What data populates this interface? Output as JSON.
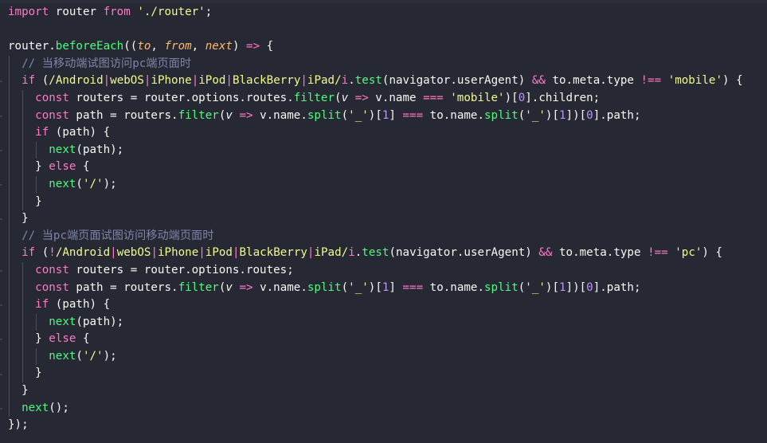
{
  "colors": {
    "background": "#262834",
    "keyword": "#ff79c6",
    "function": "#50fa7b",
    "string": "#f1fa8c",
    "number": "#bd93f9",
    "parameter": "#ffb86c",
    "comment": "#7e84a8",
    "text": "#f8f8f2"
  },
  "lines": [
    {
      "indent": 0,
      "tokens": [
        [
          "kw",
          "import"
        ],
        [
          "pl",
          " router "
        ],
        [
          "kw",
          "from"
        ],
        [
          "pl",
          " "
        ],
        [
          "str",
          "'./router'"
        ],
        [
          "pl",
          ";"
        ]
      ]
    },
    {
      "indent": 0,
      "tokens": []
    },
    {
      "indent": 0,
      "tokens": [
        [
          "pl",
          "router."
        ],
        [
          "fn",
          "beforeEach"
        ],
        [
          "pl",
          "(("
        ],
        [
          "prm",
          "to"
        ],
        [
          "pl",
          ", "
        ],
        [
          "prm",
          "from"
        ],
        [
          "pl",
          ", "
        ],
        [
          "prm",
          "next"
        ],
        [
          "pl",
          ") "
        ],
        [
          "kw",
          "=>"
        ],
        [
          "pl",
          " {"
        ]
      ]
    },
    {
      "indent": 1,
      "tokens": [
        [
          "cmt",
          "// 当移动端试图访问pc端页面时"
        ]
      ]
    },
    {
      "indent": 1,
      "tokens": [
        [
          "kw",
          "if"
        ],
        [
          "pl",
          " ("
        ],
        [
          "rx",
          "/Android"
        ],
        [
          "rxop",
          "|"
        ],
        [
          "rx",
          "webOS"
        ],
        [
          "rxop",
          "|"
        ],
        [
          "rx",
          "iPhone"
        ],
        [
          "rxop",
          "|"
        ],
        [
          "rx",
          "iPod"
        ],
        [
          "rxop",
          "|"
        ],
        [
          "rx",
          "BlackBerry"
        ],
        [
          "rxop",
          "|"
        ],
        [
          "rx",
          "iPad/"
        ],
        [
          "kw",
          "i"
        ],
        [
          "pl",
          "."
        ],
        [
          "fn",
          "test"
        ],
        [
          "pl",
          "(navigator.userAgent) "
        ],
        [
          "kw",
          "&&"
        ],
        [
          "pl",
          " to.meta.type "
        ],
        [
          "kw",
          "!=="
        ],
        [
          "pl",
          " "
        ],
        [
          "str",
          "'mobile'"
        ],
        [
          "pl",
          ") {"
        ]
      ]
    },
    {
      "indent": 2,
      "tokens": [
        [
          "kw",
          "const"
        ],
        [
          "pl",
          " routers = router.options.routes."
        ],
        [
          "fn",
          "filter"
        ],
        [
          "pl",
          "("
        ],
        [
          "vparam",
          "v"
        ],
        [
          "pl",
          " "
        ],
        [
          "kw",
          "=>"
        ],
        [
          "pl",
          " v.name "
        ],
        [
          "kw",
          "==="
        ],
        [
          "pl",
          " "
        ],
        [
          "str",
          "'mobile'"
        ],
        [
          "pl",
          ")["
        ],
        [
          "num",
          "0"
        ],
        [
          "pl",
          "].children;"
        ]
      ]
    },
    {
      "indent": 2,
      "tokens": [
        [
          "kw",
          "const"
        ],
        [
          "pl",
          " path = routers."
        ],
        [
          "fn",
          "filter"
        ],
        [
          "pl",
          "("
        ],
        [
          "vparam",
          "v"
        ],
        [
          "pl",
          " "
        ],
        [
          "kw",
          "=>"
        ],
        [
          "pl",
          " v.name."
        ],
        [
          "fn",
          "split"
        ],
        [
          "pl",
          "("
        ],
        [
          "str",
          "'_'"
        ],
        [
          "pl",
          ")["
        ],
        [
          "num",
          "1"
        ],
        [
          "pl",
          "] "
        ],
        [
          "kw",
          "==="
        ],
        [
          "pl",
          " to.name."
        ],
        [
          "fn",
          "split"
        ],
        [
          "pl",
          "("
        ],
        [
          "str",
          "'_'"
        ],
        [
          "pl",
          ")["
        ],
        [
          "num",
          "1"
        ],
        [
          "pl",
          "])["
        ],
        [
          "num",
          "0"
        ],
        [
          "pl",
          "].path;"
        ]
      ]
    },
    {
      "indent": 2,
      "tokens": [
        [
          "kw",
          "if"
        ],
        [
          "pl",
          " (path) {"
        ]
      ]
    },
    {
      "indent": 3,
      "tokens": [
        [
          "fn",
          "next"
        ],
        [
          "pl",
          "(path);"
        ]
      ]
    },
    {
      "indent": 2,
      "tokens": [
        [
          "pl",
          "} "
        ],
        [
          "kw",
          "else"
        ],
        [
          "pl",
          " {"
        ]
      ]
    },
    {
      "indent": 3,
      "tokens": [
        [
          "fn",
          "next"
        ],
        [
          "pl",
          "("
        ],
        [
          "str",
          "'/'"
        ],
        [
          "pl",
          ");"
        ]
      ]
    },
    {
      "indent": 2,
      "tokens": [
        [
          "pl",
          "}"
        ]
      ]
    },
    {
      "indent": 1,
      "tokens": [
        [
          "pl",
          "}"
        ]
      ]
    },
    {
      "indent": 1,
      "tokens": [
        [
          "cmt",
          "// 当pc端页面试图访问移动端页面时"
        ]
      ]
    },
    {
      "indent": 1,
      "tokens": [
        [
          "kw",
          "if"
        ],
        [
          "pl",
          " ("
        ],
        [
          "kw",
          "!"
        ],
        [
          "rx",
          "/Android"
        ],
        [
          "rxop",
          "|"
        ],
        [
          "rx",
          "webOS"
        ],
        [
          "rxop",
          "|"
        ],
        [
          "rx",
          "iPhone"
        ],
        [
          "rxop",
          "|"
        ],
        [
          "rx",
          "iPod"
        ],
        [
          "rxop",
          "|"
        ],
        [
          "rx",
          "BlackBerry"
        ],
        [
          "rxop",
          "|"
        ],
        [
          "rx",
          "iPad/"
        ],
        [
          "kw",
          "i"
        ],
        [
          "pl",
          "."
        ],
        [
          "fn",
          "test"
        ],
        [
          "pl",
          "(navigator.userAgent) "
        ],
        [
          "kw",
          "&&"
        ],
        [
          "pl",
          " to.meta.type "
        ],
        [
          "kw",
          "!=="
        ],
        [
          "pl",
          " "
        ],
        [
          "str",
          "'pc'"
        ],
        [
          "pl",
          ") {"
        ]
      ]
    },
    {
      "indent": 2,
      "tokens": [
        [
          "kw",
          "const"
        ],
        [
          "pl",
          " routers = router.options.routes;"
        ]
      ]
    },
    {
      "indent": 2,
      "tokens": [
        [
          "kw",
          "const"
        ],
        [
          "pl",
          " path = routers."
        ],
        [
          "fn",
          "filter"
        ],
        [
          "pl",
          "("
        ],
        [
          "vparam",
          "v"
        ],
        [
          "pl",
          " "
        ],
        [
          "kw",
          "=>"
        ],
        [
          "pl",
          " v.name."
        ],
        [
          "fn",
          "split"
        ],
        [
          "pl",
          "("
        ],
        [
          "str",
          "'_'"
        ],
        [
          "pl",
          ")["
        ],
        [
          "num",
          "1"
        ],
        [
          "pl",
          "] "
        ],
        [
          "kw",
          "==="
        ],
        [
          "pl",
          " to.name."
        ],
        [
          "fn",
          "split"
        ],
        [
          "pl",
          "("
        ],
        [
          "str",
          "'_'"
        ],
        [
          "pl",
          ")["
        ],
        [
          "num",
          "1"
        ],
        [
          "pl",
          "])["
        ],
        [
          "num",
          "0"
        ],
        [
          "pl",
          "].path;"
        ]
      ]
    },
    {
      "indent": 2,
      "tokens": [
        [
          "kw",
          "if"
        ],
        [
          "pl",
          " (path) {"
        ]
      ]
    },
    {
      "indent": 3,
      "tokens": [
        [
          "fn",
          "next"
        ],
        [
          "pl",
          "(path);"
        ]
      ]
    },
    {
      "indent": 2,
      "tokens": [
        [
          "pl",
          "} "
        ],
        [
          "kw",
          "else"
        ],
        [
          "pl",
          " {"
        ]
      ]
    },
    {
      "indent": 3,
      "tokens": [
        [
          "fn",
          "next"
        ],
        [
          "pl",
          "("
        ],
        [
          "str",
          "'/'"
        ],
        [
          "pl",
          ");"
        ]
      ]
    },
    {
      "indent": 2,
      "tokens": [
        [
          "pl",
          "}"
        ]
      ]
    },
    {
      "indent": 1,
      "tokens": [
        [
          "pl",
          "}"
        ]
      ]
    },
    {
      "indent": 1,
      "tokens": [
        [
          "fn",
          "next"
        ],
        [
          "pl",
          "();"
        ]
      ]
    },
    {
      "indent": 0,
      "tokens": [
        [
          "pl",
          "});"
        ]
      ]
    }
  ]
}
